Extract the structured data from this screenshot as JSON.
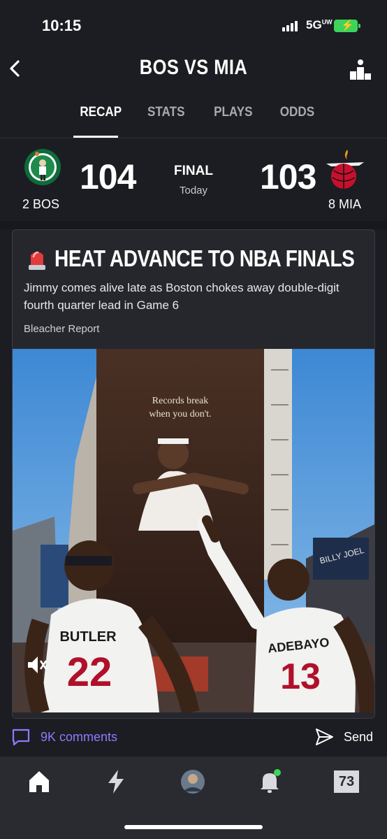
{
  "status_bar": {
    "time": "10:15",
    "network": "5G",
    "network_sup": "UW"
  },
  "header": {
    "title": "BOS VS MIA"
  },
  "tabs": [
    {
      "label": "RECAP",
      "active": true
    },
    {
      "label": "STATS",
      "active": false
    },
    {
      "label": "PLAYS",
      "active": false
    },
    {
      "label": "ODDS",
      "active": false
    }
  ],
  "scoreboard": {
    "away": {
      "seed_abbr": "2 BOS",
      "score": "104"
    },
    "home": {
      "seed_abbr": "8 MIA",
      "score": "103"
    },
    "status": "FINAL",
    "date": "Today"
  },
  "article": {
    "headline": "HEAT ADVANCE TO NBA FINALS",
    "subtitle": "Jimmy comes alive late as Boston chokes away double-digit fourth quarter lead in Game 6",
    "source": "Bleacher Report",
    "image": {
      "billboard_text_1": "Records break",
      "billboard_text_2": "when you don't.",
      "player_left_name": "BUTLER",
      "player_left_number": "22",
      "player_right_name": "ADEBAYO",
      "player_right_number": "13",
      "sign_text": "BILLY JOEL"
    }
  },
  "social": {
    "comments": "9K comments",
    "send": "Send"
  },
  "tab_bar": {
    "scores_icon_text": "73"
  },
  "colors": {
    "accent": "#8b7bff",
    "background": "#1c1d22",
    "card": "#26272d",
    "battery": "#3ed35a"
  }
}
